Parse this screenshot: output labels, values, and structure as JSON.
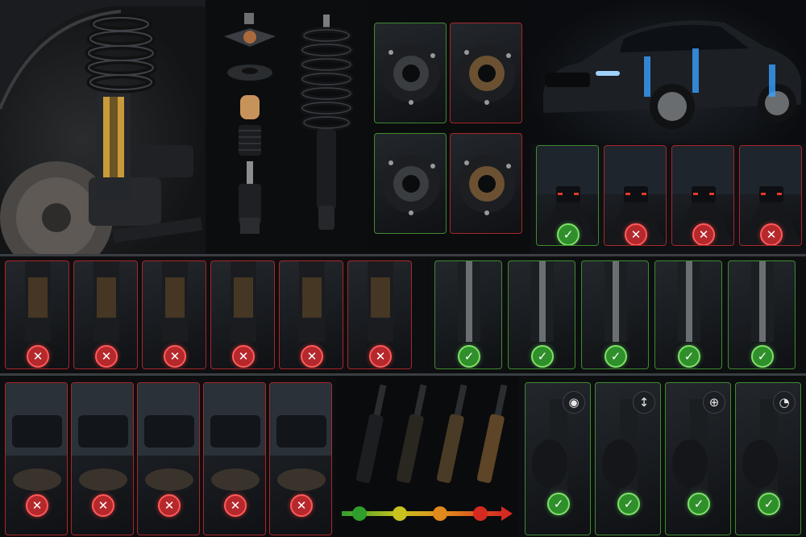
{
  "colors": {
    "background": "#0b0d10",
    "bad": "#b5282c",
    "good": "#2f8f2a",
    "tile_border_bad": "#a8262a",
    "tile_border_good": "#3f8a2f",
    "metal": "#2b2f34",
    "scale": [
      "#2f9e2a",
      "#c7c21f",
      "#e0891c",
      "#d52a22"
    ]
  },
  "badges": {
    "bad_symbol": "✕",
    "good_symbol": "✓"
  },
  "top_left_photo": {
    "subject": "wheel-suspension-cutaway"
  },
  "exploded_view": {
    "parts": [
      "strut-mount-top",
      "bearing-plate",
      "bump-stop",
      "dust-boot",
      "shock-absorber"
    ],
    "assembled": "strut-coil-assembly"
  },
  "strut_mounts": [
    {
      "state": "good",
      "style": "mount-top-clean"
    },
    {
      "state": "bad",
      "style": "mount-top-worn"
    },
    {
      "state": "good",
      "style": "mount-bottom-clean"
    },
    {
      "state": "bad",
      "style": "mount-bottom-worn"
    }
  ],
  "car_hero": {
    "subject": "sedan-with-highlighted-struts"
  },
  "road_tests": [
    {
      "state": "good"
    },
    {
      "state": "bad"
    },
    {
      "state": "bad"
    },
    {
      "state": "bad"
    }
  ],
  "worn_parts": [
    {
      "state": "bad",
      "part": "leaking-shock"
    },
    {
      "state": "bad",
      "part": "rusty-shock"
    },
    {
      "state": "bad",
      "part": "oily-shock"
    },
    {
      "state": "bad",
      "part": "broken-spring"
    },
    {
      "state": "bad",
      "part": "torn-boot"
    },
    {
      "state": "bad",
      "part": "cracked-mount"
    }
  ],
  "good_parts": [
    {
      "state": "good",
      "part": "clean-shock"
    },
    {
      "state": "good",
      "part": "clean-rod"
    },
    {
      "state": "good",
      "part": "intact-spring"
    },
    {
      "state": "good",
      "part": "intact-boot"
    },
    {
      "state": "good",
      "part": "intact-mount"
    }
  ],
  "symptoms": [
    {
      "state": "bad",
      "symptom": "nose-dive"
    },
    {
      "state": "bad",
      "symptom": "bouncing"
    },
    {
      "state": "bad",
      "symptom": "uneven-tire-wear"
    },
    {
      "state": "bad",
      "symptom": "tire-damage"
    },
    {
      "state": "bad",
      "symptom": "debris"
    }
  ],
  "wear_scale": {
    "stages": 4
  },
  "inspection": [
    {
      "state": "good",
      "icon": "eye-icon"
    },
    {
      "state": "good",
      "icon": "up-down-arrow-icon"
    },
    {
      "state": "good",
      "icon": "target-icon"
    },
    {
      "state": "good",
      "icon": "gauge-icon"
    }
  ]
}
